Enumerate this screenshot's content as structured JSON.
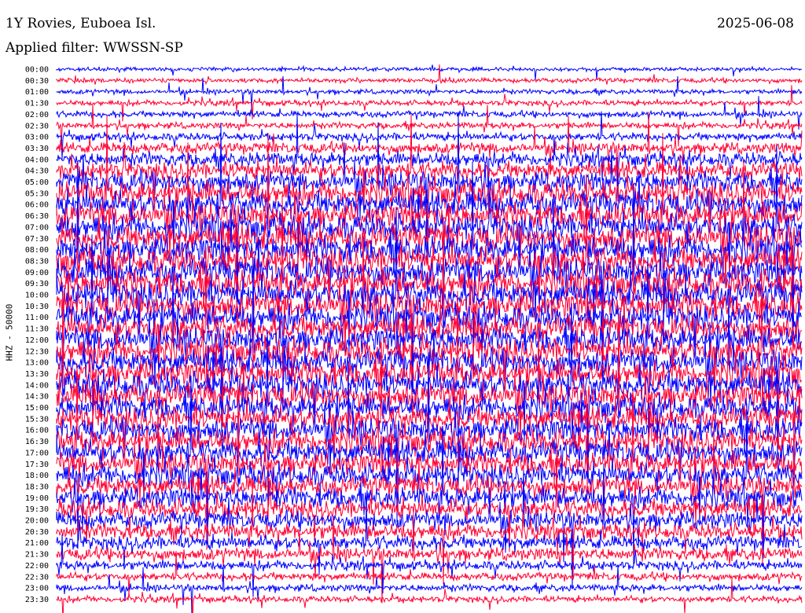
{
  "header": {
    "station": "1Y Rovies, Euboea Isl.",
    "date": "2025-06-08",
    "filter": "Applied filter: WWSSN-SP"
  },
  "chart_data": {
    "type": "line",
    "channel_label": "HHZ - 50000",
    "row_times": [
      "00:00",
      "00:30",
      "01:00",
      "01:30",
      "02:00",
      "02:30",
      "03:00",
      "03:30",
      "04:00",
      "04:30",
      "05:00",
      "05:30",
      "06:00",
      "06:30",
      "07:00",
      "07:30",
      "08:00",
      "08:30",
      "09:00",
      "09:30",
      "10:00",
      "10:30",
      "11:00",
      "11:30",
      "12:00",
      "12:30",
      "13:00",
      "13:30",
      "14:00",
      "14:30",
      "15:00",
      "15:30",
      "16:00",
      "16:30",
      "17:00",
      "17:30",
      "18:00",
      "18:30",
      "19:00",
      "19:30",
      "20:00",
      "20:30",
      "21:00",
      "21:30",
      "22:00",
      "22:30",
      "23:00",
      "23:30"
    ],
    "trace_colors": [
      "#0000ff",
      "#ff0033"
    ],
    "relative_amplitude": [
      0.25,
      0.3,
      0.3,
      0.35,
      0.4,
      0.4,
      0.5,
      0.7,
      0.9,
      1.1,
      1.3,
      1.5,
      1.6,
      1.6,
      1.6,
      1.7,
      1.7,
      1.7,
      1.7,
      1.7,
      1.7,
      1.7,
      1.6,
      1.6,
      1.6,
      1.6,
      1.6,
      1.6,
      1.6,
      1.6,
      1.5,
      1.5,
      1.5,
      1.5,
      1.5,
      1.4,
      1.4,
      1.3,
      1.3,
      1.2,
      1.1,
      1.0,
      0.9,
      0.8,
      0.6,
      0.5,
      0.45,
      0.4
    ]
  }
}
